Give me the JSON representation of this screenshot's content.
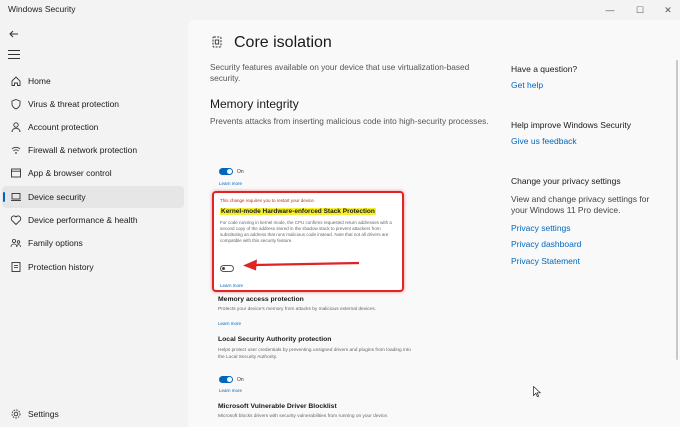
{
  "window": {
    "title": "Windows Security"
  },
  "sidebar": {
    "items": [
      {
        "label": "Home"
      },
      {
        "label": "Virus & threat protection"
      },
      {
        "label": "Account protection"
      },
      {
        "label": "Firewall & network protection"
      },
      {
        "label": "App & browser control"
      },
      {
        "label": "Device security"
      },
      {
        "label": "Device performance & health"
      },
      {
        "label": "Family options"
      },
      {
        "label": "Protection history"
      }
    ],
    "settings_label": "Settings"
  },
  "main": {
    "title": "Core isolation",
    "description": "Security features available on your device that use virtualization-based security.",
    "memory_integrity": {
      "title": "Memory integrity",
      "description": "Prevents attacks from inserting malicious code into high-security processes.",
      "toggle_label": "On",
      "learn_more": "Learn more"
    },
    "kernel": {
      "restart_note": "This change requires you to restart your device.",
      "title": "Kernel-mode Hardware-enforced Stack Protection",
      "description": "For code running in kernel mode, the CPU confirms requested return addresses with a second copy of the address stored in the shadow stack to prevent attackers from substituting an address that runs malicious code instead. Note that not all drivers are compatible with this security feature.",
      "learn_more": "Learn more"
    },
    "memory_access": {
      "title": "Memory access protection",
      "description": "Protects your device's memory from attacks by malicious external devices.",
      "learn_more": "Learn more"
    },
    "lsa": {
      "title": "Local Security Authority protection",
      "description": "Helps protect user credentials by preventing unsigned drivers and plugins from loading into the Local Security Authority.",
      "toggle_label": "On",
      "learn_more": "Learn more"
    },
    "driver_blocklist": {
      "title": "Microsoft Vulnerable Driver Blocklist",
      "description": "Microsoft blocks drivers with security vulnerabilities from running on your device."
    }
  },
  "right": {
    "question_heading": "Have a question?",
    "get_help": "Get help",
    "improve_heading": "Help improve Windows Security",
    "feedback": "Give us feedback",
    "privacy_heading": "Change your privacy settings",
    "privacy_text": "View and change privacy settings for your Windows 11 Pro device.",
    "privacy_settings": "Privacy settings",
    "privacy_dashboard": "Privacy dashboard",
    "privacy_statement": "Privacy Statement"
  },
  "colors": {
    "accent": "#0067c0",
    "highlight": "#f5ef2e",
    "annotation": "#e02424"
  }
}
